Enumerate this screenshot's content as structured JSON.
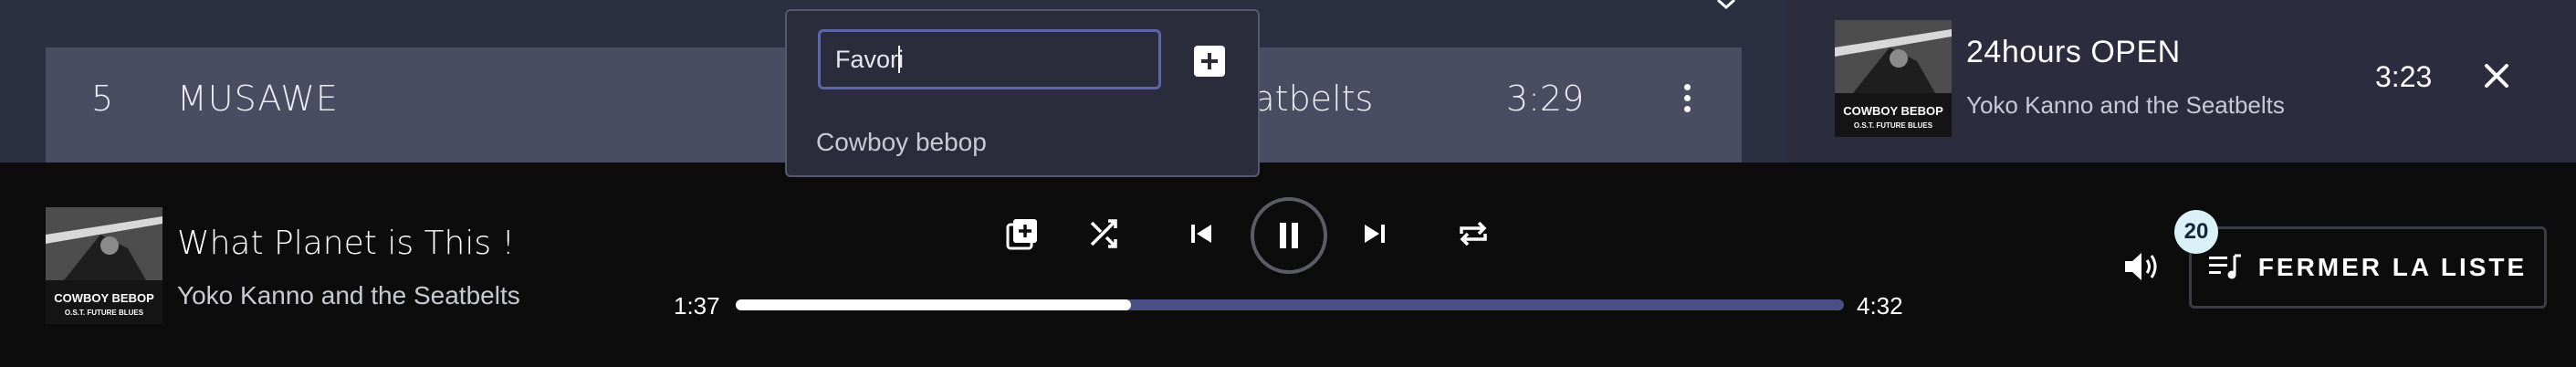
{
  "track_row": {
    "number": "5",
    "title": "MUSAWE",
    "artist": "eatbelts",
    "duration": "3:29"
  },
  "queue": {
    "current": {
      "title": "24hours OPEN",
      "artist": "Yoko Kanno and the Seatbelts",
      "duration": "3:23",
      "cover_title": "COWBOY BEBOP",
      "cover_sub": "O.S.T. FUTURE BLUES"
    }
  },
  "playlist_popup": {
    "input_value": "Favori",
    "items": [
      "Cowboy bebop"
    ]
  },
  "player": {
    "title": "What Planet is This !",
    "artist": "Yoko Kanno and the Seatbelts",
    "cover_title": "COWBOY BEBOP",
    "cover_sub": "O.S.T. FUTURE BLUES",
    "elapsed": "1:37",
    "total": "4:32",
    "progress": 0.357,
    "queue_count": "20",
    "close_list_label": "FERMER LA LISTE"
  },
  "icons": {
    "more": "more-vertical-icon",
    "close": "close-icon",
    "add": "plus-square-icon",
    "add_queue": "add-to-queue-icon",
    "shuffle": "shuffle-icon",
    "prev": "skip-back-icon",
    "pause": "pause-icon",
    "next": "skip-forward-icon",
    "repeat": "repeat-icon",
    "volume": "volume-icon",
    "list": "playlist-icon"
  },
  "colors": {
    "top_bg": "#2c2e41",
    "row_bg": "#4a4c61",
    "progress_track": "#4a4f86",
    "input_border": "#5d66a8",
    "badge_bg": "#d9f1f7"
  }
}
